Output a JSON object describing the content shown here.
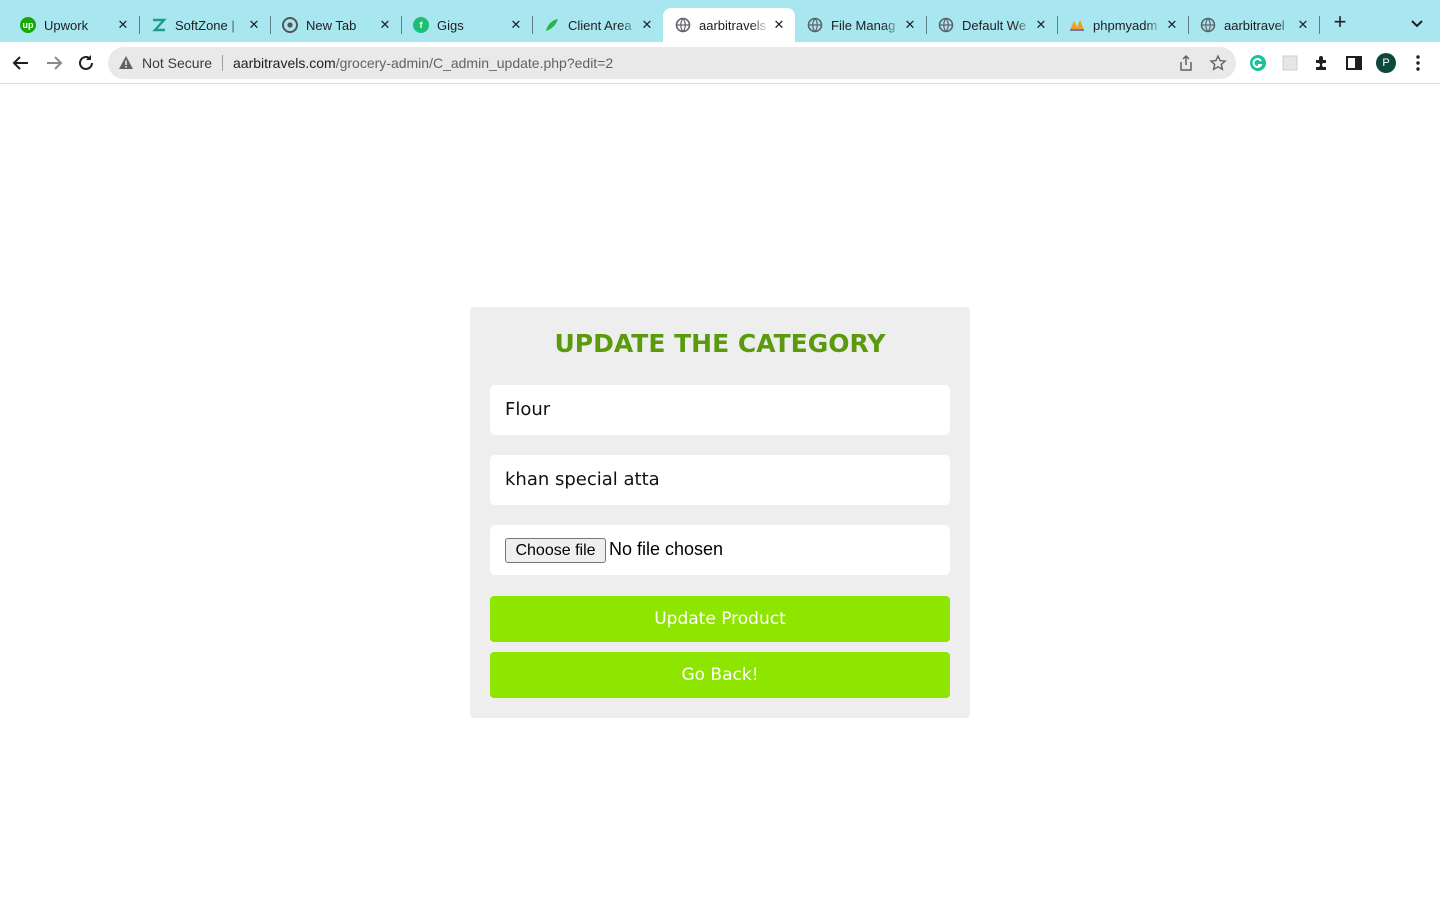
{
  "browser": {
    "tabs": [
      {
        "title": "Upwork",
        "icon": "upwork-icon"
      },
      {
        "title": "SoftZone |",
        "icon": "softzone-icon"
      },
      {
        "title": "New Tab",
        "icon": "chrome-icon"
      },
      {
        "title": "Gigs",
        "icon": "fiverr-icon"
      },
      {
        "title": "Client Area",
        "icon": "hosting-leaf-icon"
      },
      {
        "title": "aarbitravels",
        "icon": "globe-icon",
        "active": true
      },
      {
        "title": "File Manag",
        "icon": "globe-icon"
      },
      {
        "title": "Default We",
        "icon": "globe-icon"
      },
      {
        "title": "phpmyadm",
        "icon": "phpmyadmin-icon"
      },
      {
        "title": "aarbitravel",
        "icon": "globe-icon"
      }
    ],
    "new_tab_label": "+",
    "security_label": "Not Secure",
    "url_host": "aarbitravels.com",
    "url_path": "/grocery-admin/C_admin_update.php?edit=2",
    "profile_initial": "P"
  },
  "page": {
    "title": "UPDATE THE CATEGORY",
    "category_value": "Flour",
    "product_value": "khan special atta",
    "file_button_label": "Choose file",
    "file_status": "No file chosen",
    "update_button_label": "Update Product",
    "back_button_label": "Go Back!"
  },
  "colors": {
    "accent_green": "#8ee600",
    "title_green": "#5a9a0c",
    "tabstrip": "#a8e6f0",
    "card_bg": "#eeeeee"
  }
}
